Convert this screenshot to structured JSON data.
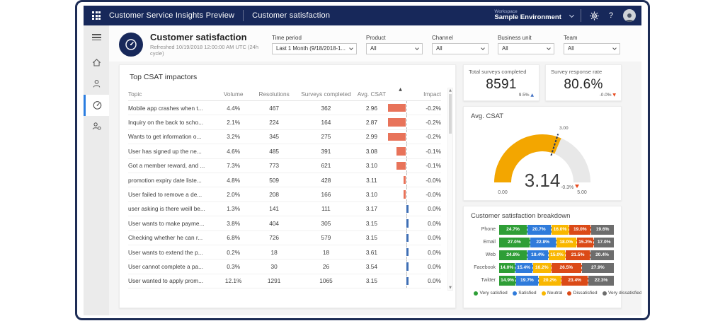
{
  "topbar": {
    "app_title": "Customer Service Insights Preview",
    "page_title": "Customer satisfaction",
    "workspace_label": "Workspace",
    "workspace_value": "Sample Environment",
    "help_label": "?"
  },
  "header": {
    "title": "Customer satisfaction",
    "refreshed": "Refreshed 10/19/2018 12:00:00 AM UTC (24h cycle)"
  },
  "filters": [
    {
      "label": "Time period",
      "value": "Last 1 Month (9/18/2018-1..."
    },
    {
      "label": "Product",
      "value": "All"
    },
    {
      "label": "Channel",
      "value": "All"
    },
    {
      "label": "Business unit",
      "value": "All"
    },
    {
      "label": "Team",
      "value": "All"
    }
  ],
  "kpis": [
    {
      "title": "Total surveys completed",
      "value": "8591",
      "delta": "9.5%",
      "direction": "up"
    },
    {
      "title": "Survey response rate",
      "value": "80.6%",
      "delta": "-0.0%",
      "direction": "down"
    }
  ],
  "impactors": {
    "title": "Top CSAT impactors",
    "columns": [
      "Topic",
      "Volume",
      "Resolutions",
      "Surveys completed",
      "Avg. CSAT",
      "Impact"
    ],
    "sort_icon": "▲",
    "rows": [
      {
        "topic": "Mobile app crashes when t...",
        "volume": "4.4%",
        "resolutions": "467",
        "surveys": "362",
        "csat": "2.96",
        "impact": "-0.2%"
      },
      {
        "topic": "Inquiry on the back to scho...",
        "volume": "2.1%",
        "resolutions": "224",
        "surveys": "164",
        "csat": "2.87",
        "impact": "-0.2%"
      },
      {
        "topic": "Wants to get information o...",
        "volume": "3.2%",
        "resolutions": "345",
        "surveys": "275",
        "csat": "2.99",
        "impact": "-0.2%"
      },
      {
        "topic": "User has signed up the ne...",
        "volume": "4.6%",
        "resolutions": "485",
        "surveys": "391",
        "csat": "3.08",
        "impact": "-0.1%"
      },
      {
        "topic": "Got a member reward, and ...",
        "volume": "7.3%",
        "resolutions": "773",
        "surveys": "621",
        "csat": "3.10",
        "impact": "-0.1%"
      },
      {
        "topic": "promotion expiry date liste...",
        "volume": "4.8%",
        "resolutions": "509",
        "surveys": "428",
        "csat": "3.11",
        "impact": "-0.0%"
      },
      {
        "topic": "User failed to remove a de...",
        "volume": "2.0%",
        "resolutions": "208",
        "surveys": "166",
        "csat": "3.10",
        "impact": "-0.0%"
      },
      {
        "topic": "user asking is there weill be...",
        "volume": "1.3%",
        "resolutions": "141",
        "surveys": "111",
        "csat": "3.17",
        "impact": "0.0%"
      },
      {
        "topic": "User wants to make payme...",
        "volume": "3.8%",
        "resolutions": "404",
        "surveys": "305",
        "csat": "3.15",
        "impact": "0.0%"
      },
      {
        "topic": "Checking whether he can r...",
        "volume": "6.8%",
        "resolutions": "726",
        "surveys": "579",
        "csat": "3.15",
        "impact": "0.0%"
      },
      {
        "topic": "User wants to extend the p...",
        "volume": "0.2%",
        "resolutions": "18",
        "surveys": "18",
        "csat": "3.61",
        "impact": "0.0%"
      },
      {
        "topic": "User cannot complete a pa...",
        "volume": "0.3%",
        "resolutions": "30",
        "surveys": "26",
        "csat": "3.54",
        "impact": "0.0%"
      },
      {
        "topic": "User wanted to apply prom...",
        "volume": "12.1%",
        "resolutions": "1291",
        "surveys": "1065",
        "csat": "3.15",
        "impact": "0.0%"
      }
    ],
    "colors": {
      "negative_bar": "#e8735a",
      "positive_bar": "#3f6fb5"
    }
  },
  "gauge": {
    "title": "Avg. CSAT",
    "value": "3.14",
    "delta": "-0.3%",
    "min": "0.00",
    "max": "5.00",
    "target": "3.00",
    "fill_color": "#f3a600",
    "track_color": "#e8e8e8",
    "needle_color": "#25365c"
  },
  "breakdown": {
    "title": "Customer satisfaction breakdown",
    "categories": [
      "Phone",
      "Email",
      "Web",
      "Facebook",
      "Twitter"
    ],
    "series": [
      {
        "name": "Very satisfied",
        "color": "#2e9e36",
        "values": [
          24.7,
          27.0,
          24.8,
          14.0,
          14.9
        ]
      },
      {
        "name": "Satisfied",
        "color": "#2f7bdb",
        "values": [
          20.7,
          22.8,
          18.4,
          15.4,
          19.7
        ]
      },
      {
        "name": "Neutral",
        "color": "#f9b700",
        "values": [
          16.0,
          18.0,
          15.0,
          16.2,
          20.2
        ]
      },
      {
        "name": "Dissatisfied",
        "color": "#db4a17",
        "values": [
          19.0,
          15.2,
          21.5,
          26.5,
          23.4
        ]
      },
      {
        "name": "Very dissatisfied",
        "color": "#6d6d6d",
        "values": [
          19.6,
          17.0,
          20.4,
          27.9,
          22.3
        ]
      }
    ]
  },
  "chart_data": [
    {
      "type": "gauge",
      "title": "Avg. CSAT",
      "value": 3.14,
      "min": 0,
      "max": 5,
      "target": 3.0,
      "delta_pct": -0.3
    },
    {
      "type": "bar",
      "subtype": "stacked-horizontal-percent",
      "title": "Customer satisfaction breakdown",
      "categories": [
        "Phone",
        "Email",
        "Web",
        "Facebook",
        "Twitter"
      ],
      "series": [
        {
          "name": "Very satisfied",
          "values": [
            24.7,
            27.0,
            24.8,
            14.0,
            14.9
          ]
        },
        {
          "name": "Satisfied",
          "values": [
            20.7,
            22.8,
            18.4,
            15.4,
            19.7
          ]
        },
        {
          "name": "Neutral",
          "values": [
            16.0,
            18.0,
            15.0,
            16.2,
            20.2
          ]
        },
        {
          "name": "Dissatisfied",
          "values": [
            19.0,
            15.2,
            21.5,
            26.5,
            23.4
          ]
        },
        {
          "name": "Very dissatisfied",
          "values": [
            19.6,
            17.0,
            20.4,
            27.9,
            22.3
          ]
        }
      ],
      "legend_position": "bottom"
    }
  ]
}
